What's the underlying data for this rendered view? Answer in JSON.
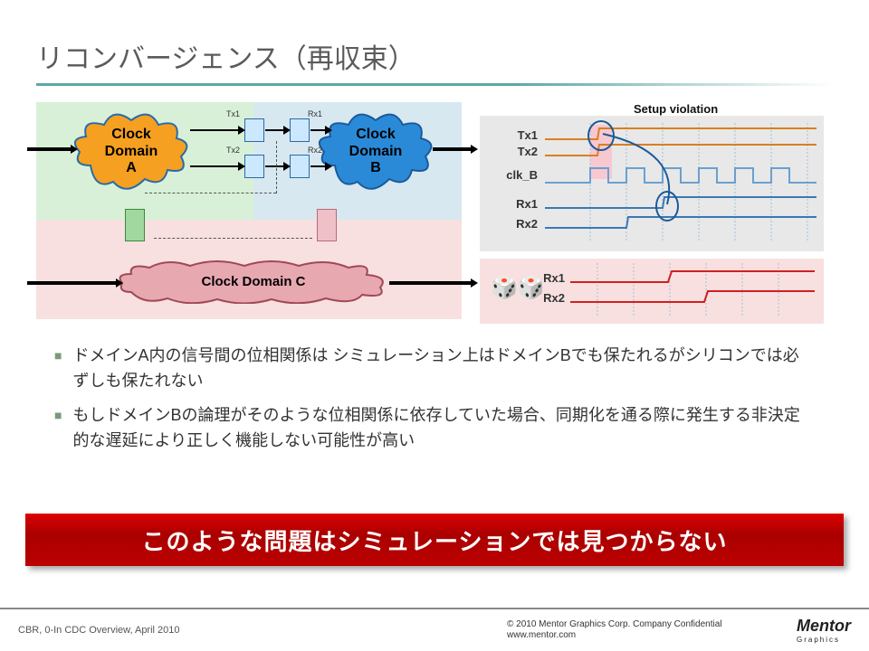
{
  "title": "リコンバージェンス（再収束）",
  "diagram": {
    "cloud_a": "Clock\nDomain\nA",
    "cloud_b": "Clock\nDomain\nB",
    "cloud_c": "Clock Domain C",
    "tx1": "Tx1",
    "tx2": "Tx2",
    "rx1": "Rx1",
    "rx2": "Rx2"
  },
  "timing": {
    "violation": "Setup violation",
    "tx1": "Tx1",
    "tx2": "Tx2",
    "clk_b": "clk_B",
    "rx1": "Rx1",
    "rx2": "Rx2",
    "dice": "🎲🎲"
  },
  "bullets": [
    "ドメインA内の信号間の位相関係は シミュレーション上はドメインBでも保たれるがシリコンでは必ずしも保たれない",
    "もしドメインBの論理がそのような位相関係に依存していた場合、同期化を通る際に発生する非決定的な遅延により正しく機能しない可能性が高い"
  ],
  "redbar": "このような問題はシミュレーションでは見つからない",
  "footer": {
    "left": "CBR, 0-In CDC Overview, April 2010",
    "copyright": "© 2010 Mentor Graphics Corp. Company Confidential",
    "url": "www.mentor.com",
    "brand": "Mentor",
    "brand_sub": "Graphics"
  }
}
